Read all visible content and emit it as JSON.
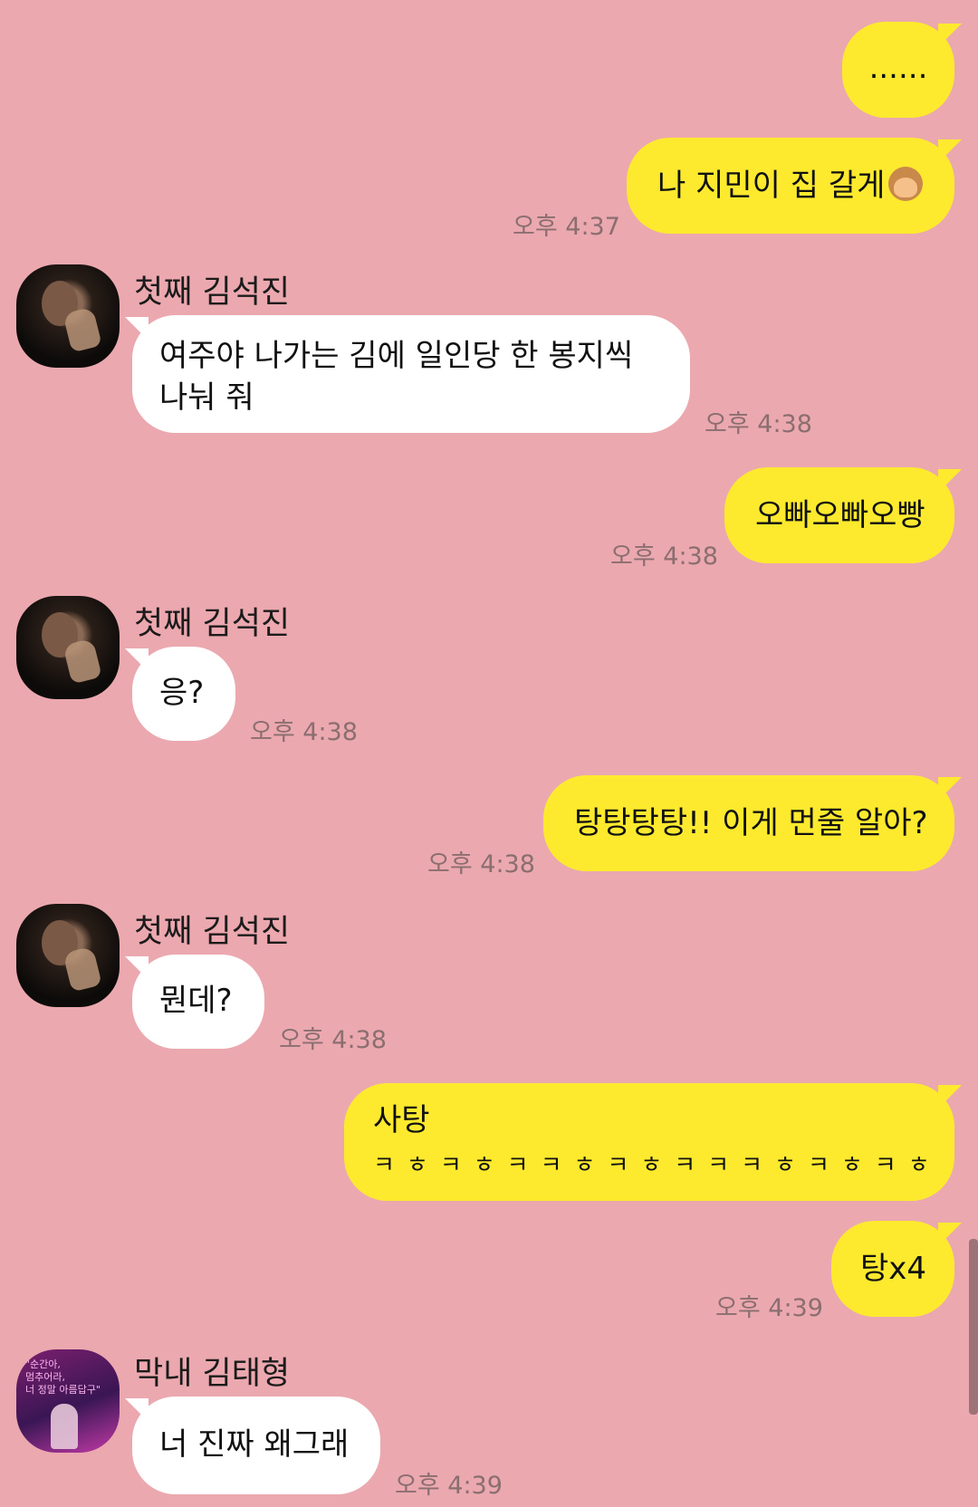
{
  "messages": [
    {
      "text": "......"
    },
    {
      "text": "나 지민이 집 갈게",
      "emoji": "facepalm-woman-emoji",
      "time": "오후 4:37"
    },
    {
      "sender": "첫째 김석진",
      "line1": "여주야 나가는 김에 일인당 한 봉지씩",
      "line2": "나눠 줘",
      "time": "오후 4:38"
    },
    {
      "text": "오빠오빠오빵",
      "time": "오후 4:38"
    },
    {
      "sender": "첫째 김석진",
      "text": "응?",
      "time": "오후 4:38"
    },
    {
      "text": "탕탕탕탕!! 이게 먼줄 알아?",
      "time": "오후 4:38"
    },
    {
      "sender": "첫째 김석진",
      "text": "뭔데?",
      "time": "오후 4:38"
    },
    {
      "line1": "사탕",
      "line2": "ㅋㅎㅋㅎㅋㅋㅎㅋㅎㅋㅋㅋㅎㅋㅎㅋㅎ"
    },
    {
      "text": "탕x4",
      "time": "오후 4:39"
    },
    {
      "sender": "막내 김태형",
      "text": "너 진짜 왜그래",
      "time": "오후 4:39"
    }
  ],
  "avatars": {
    "neon_sign": "\"순간아,\n멈추어라,\n너 정말 아름답구\""
  },
  "colors": {
    "background": "#EBA8AF",
    "my_bubble": "#FDEA2F",
    "other_bubble": "#FFFFFF"
  }
}
